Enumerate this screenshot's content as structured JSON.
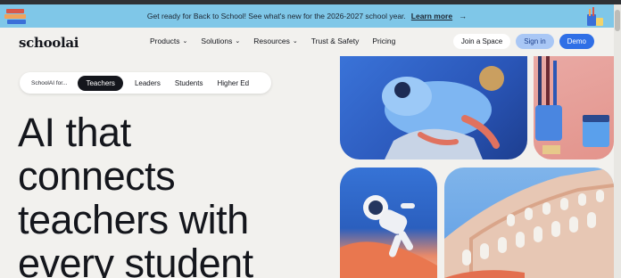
{
  "announcement": {
    "message": "Get ready for Back to School! See what's new for the 2026-2027 school year.",
    "link_label": "Learn more",
    "arrow": "→"
  },
  "nav": {
    "logo": "schoolai",
    "menu": [
      {
        "label": "Products",
        "has_dropdown": true
      },
      {
        "label": "Solutions",
        "has_dropdown": true
      },
      {
        "label": "Resources",
        "has_dropdown": true
      },
      {
        "label": "Trust & Safety",
        "has_dropdown": false
      },
      {
        "label": "Pricing",
        "has_dropdown": false
      }
    ],
    "chevron": "⌄",
    "join_label": "Join a Space",
    "signin_label": "Sign in",
    "demo_label": "Demo"
  },
  "audience": {
    "prefix": "SchoolAI for...",
    "options": [
      "Teachers",
      "Leaders",
      "Students",
      "Higher Ed"
    ],
    "selected": "Teachers"
  },
  "hero": {
    "lines": [
      "AI that",
      "connects",
      "teachers with",
      "every student"
    ]
  },
  "colors": {
    "announcement_bg": "#7fc7e8",
    "page_bg": "#f2f1ee",
    "accent": "#2f6fe6",
    "signin_bg": "#a9c7f5",
    "active_pill": "#14161c"
  },
  "images": [
    "frog-illustration",
    "paint-brushes-illustration",
    "astronaut-illustration",
    "colosseum-illustration"
  ]
}
